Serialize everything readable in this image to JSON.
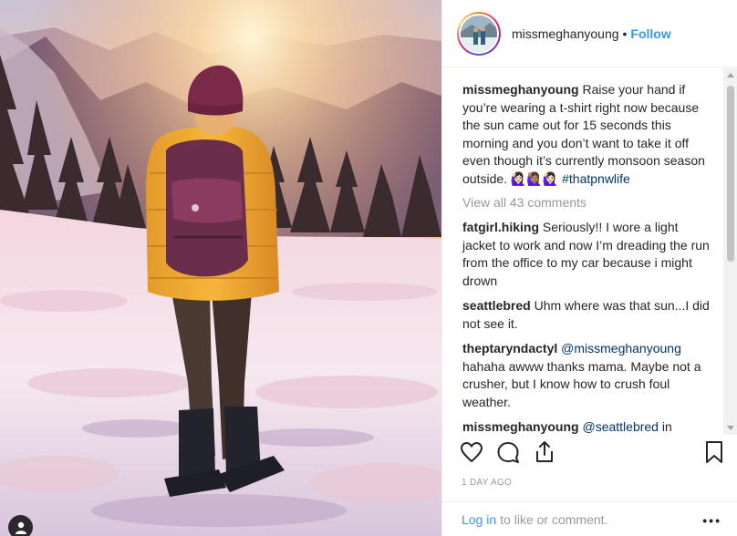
{
  "post": {
    "username": "missmeghanyoung",
    "separator": "•",
    "follow_label": "Follow",
    "caption_user": "missmeghanyoung",
    "caption_text": "Raise your hand if you’re wearing a t-shirt right now because the sun came out for 15 seconds this morning and you don’t want to take it off even though it’s currently monsoon season outside. 🙋🏻‍♀️🙋🏽‍♀️🙋🏻‍♀️",
    "caption_hashtag": "#thatpnwlife",
    "view_all_label": "View all 43 comments",
    "timestamp": "1 DAY AGO"
  },
  "comments": [
    {
      "user": "fatgirl.hiking",
      "mention": "",
      "text": "Seriously!! I wore a light jacket to work and now I’m dreading the run from the office to my car because i might drown"
    },
    {
      "user": "seattlebred",
      "mention": "",
      "text": "Uhm where was that sun...I did not see it."
    },
    {
      "user": "theptaryndactyl",
      "mention": "@missmeghanyoung",
      "text": "hahaha awww thanks mama. Maybe not a crusher, but I know how to crush foul weather."
    },
    {
      "user": "missmeghanyoung",
      "mention": "@seattlebred",
      "text": "in Westport! It’s always sunny here. Even if it’s only for a second 😄😄"
    }
  ],
  "footer": {
    "login_label": "Log in",
    "login_suffix": "to like or comment.",
    "more_label": "•••"
  },
  "icons": {
    "like": "heart-icon",
    "comment": "comment-bubble-icon",
    "share": "share-icon",
    "save": "bookmark-icon",
    "user_tags": "person-icon"
  },
  "colors": {
    "link_blue": "#3897f0",
    "mention_blue": "#003569",
    "muted_text": "#999999"
  }
}
